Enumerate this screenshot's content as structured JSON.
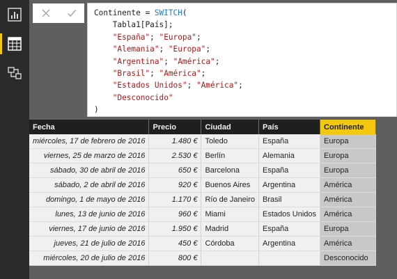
{
  "sidebar": {
    "items": [
      {
        "name": "report-view",
        "icon": "bar-chart-icon"
      },
      {
        "name": "data-view",
        "icon": "table-grid-icon",
        "active": true
      },
      {
        "name": "relationships-view",
        "icon": "relationship-diagram-icon"
      }
    ],
    "accent": "#f2c811"
  },
  "formula_bar": {
    "cancel_icon": "close-icon",
    "commit_icon": "check-icon",
    "lines": {
      "l1a": "Continente = ",
      "l1b": "SWITCH",
      "l1c": "(",
      "l2": "    Tabla1[País];",
      "l3a": "    ",
      "l3b": "\"España\"",
      "l3c": "; ",
      "l3d": "\"Europa\"",
      "l3e": ";",
      "l4b": "\"Alemania\"",
      "l4d": "\"Europa\"",
      "l5b": "\"Argentina\"",
      "l5d": "\"América\"",
      "l6b": "\"Brasil\"",
      "l6d": "\"América\"",
      "l7b": "\"Estados Unidos\"",
      "l7d": "\"América\"",
      "l8b": "\"Desconocido\"",
      "l9": ")"
    }
  },
  "table": {
    "headers": {
      "fecha": "Fecha",
      "precio": "Precio",
      "ciudad": "Ciudad",
      "pais": "País",
      "continente": "Continente"
    },
    "rows": [
      {
        "fecha": "miércoles, 17 de febrero de 2016",
        "precio": "1.480 €",
        "ciudad": "Toledo",
        "pais": "España",
        "continente": "Europa"
      },
      {
        "fecha": "viernes, 25 de marzo de 2016",
        "precio": "2.530 €",
        "ciudad": "Berlín",
        "pais": "Alemania",
        "continente": "Europa"
      },
      {
        "fecha": "sábado, 30 de abril de 2016",
        "precio": "650 €",
        "ciudad": "Barcelona",
        "pais": "España",
        "continente": "Europa"
      },
      {
        "fecha": "sábado, 2 de abril de 2016",
        "precio": "920 €",
        "ciudad": "Buenos Aires",
        "pais": "Argentina",
        "continente": "América"
      },
      {
        "fecha": "domingo, 1 de mayo de 2016",
        "precio": "1.170 €",
        "ciudad": "Río de Janeiro",
        "pais": "Brasil",
        "continente": "América"
      },
      {
        "fecha": "lunes, 13 de junio de 2016",
        "precio": "960 €",
        "ciudad": "Miami",
        "pais": "Estados Unidos",
        "continente": "América"
      },
      {
        "fecha": "viernes, 17 de junio de 2016",
        "precio": "1.950 €",
        "ciudad": "Madrid",
        "pais": "España",
        "continente": "Europa"
      },
      {
        "fecha": "jueves, 21 de julio de 2016",
        "precio": "450 €",
        "ciudad": "Córdoba",
        "pais": "Argentina",
        "continente": "América"
      },
      {
        "fecha": "miércoles, 20 de julio de 2016",
        "precio": "800 €",
        "ciudad": "",
        "pais": "",
        "continente": "Desconocido"
      }
    ]
  },
  "colors": {
    "selected_header": "#f2c811",
    "selected_column": "#c8c8c8",
    "dax_function": "#1e7ad6",
    "dax_string": "#b31515"
  }
}
